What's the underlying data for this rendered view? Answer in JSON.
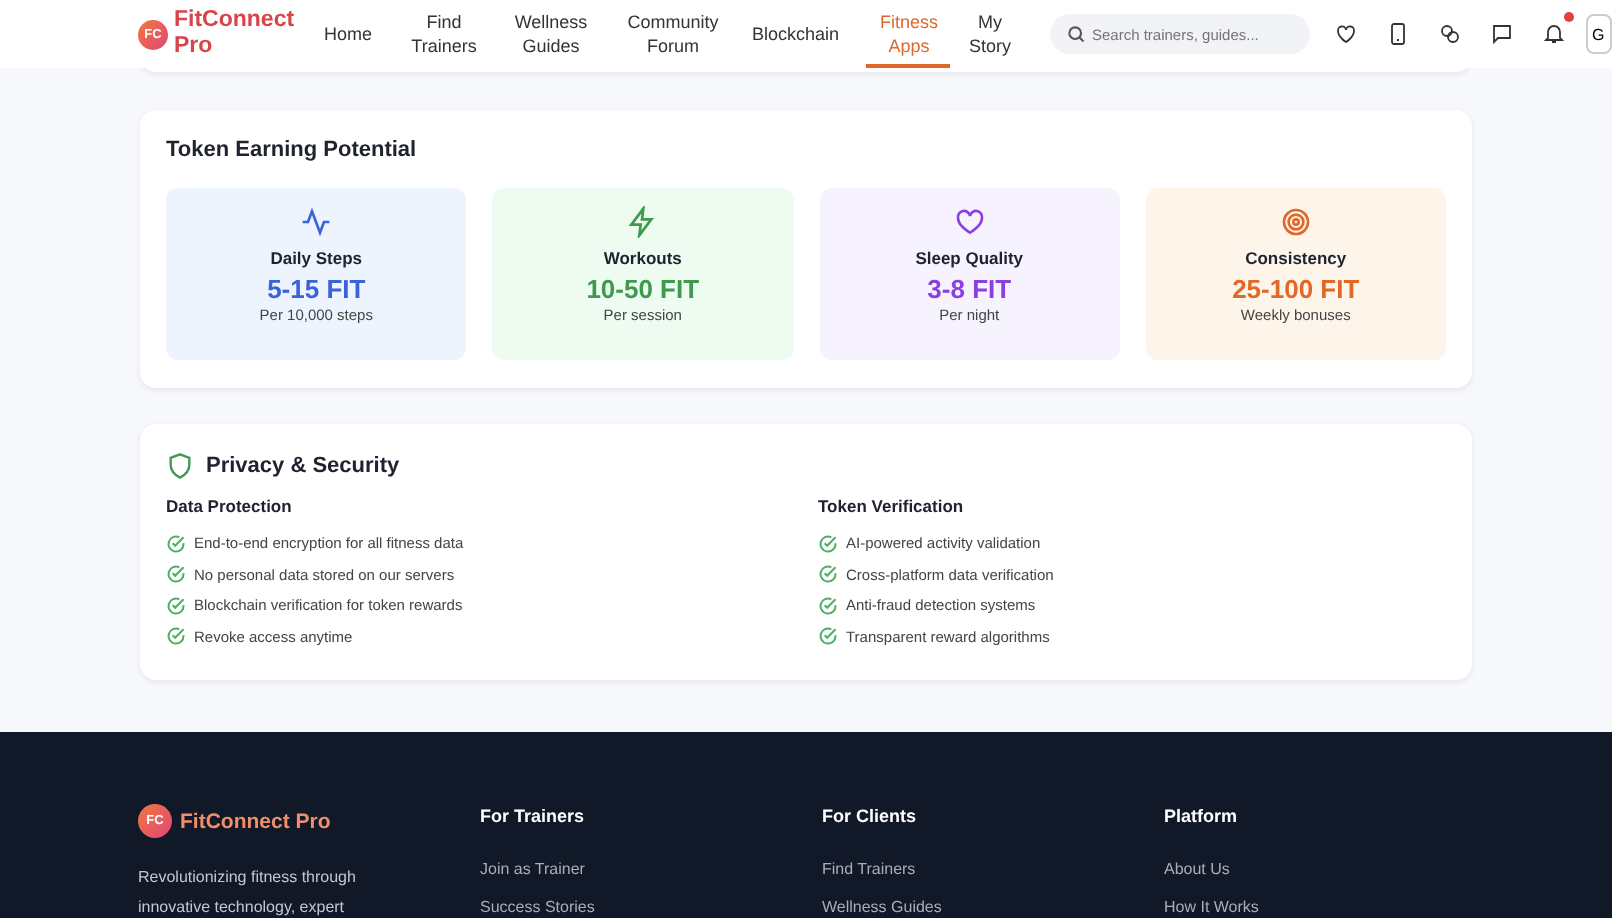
{
  "header": {
    "logo_mark": "FC",
    "logo_text": "FitConnect Pro",
    "nav": [
      {
        "label": "Home",
        "selected": false
      },
      {
        "label": "Find Trainers",
        "selected": false
      },
      {
        "label": "Wellness Guides",
        "selected": false
      },
      {
        "label": "Community Forum",
        "selected": false
      },
      {
        "label": "Blockchain",
        "selected": false
      },
      {
        "label": "Fitness Apps",
        "selected": true
      },
      {
        "label": "My Story",
        "selected": false
      }
    ],
    "search": {
      "placeholder": "Search trainers, guides..."
    },
    "notification_dot": true,
    "profile_initial": "G"
  },
  "earning": {
    "title": "Token Earning Potential",
    "cards": [
      {
        "kind": "steps",
        "title": "Daily Steps",
        "amount": "5-15 FIT",
        "note": "Per 10,000 steps",
        "color": "#3b63d8"
      },
      {
        "kind": "workouts",
        "title": "Workouts",
        "amount": "10-50 FIT",
        "note": "Per session",
        "color": "#3f9a4f"
      },
      {
        "kind": "sleep",
        "title": "Sleep Quality",
        "amount": "3-8 FIT",
        "note": "Per night",
        "color": "#8b3fe0"
      },
      {
        "kind": "consistency",
        "title": "Consistency",
        "amount": "25-100 FIT",
        "note": "Weekly bonuses",
        "color": "#e0692a"
      }
    ]
  },
  "privacy": {
    "title": "Privacy & Security",
    "columns": [
      {
        "heading": "Data Protection",
        "items": [
          "End-to-end encryption for all fitness data",
          "No personal data stored on our servers",
          "Blockchain verification for token rewards",
          "Revoke access anytime"
        ]
      },
      {
        "heading": "Token Verification",
        "items": [
          "AI-powered activity validation",
          "Cross-platform data verification",
          "Anti-fraud detection systems",
          "Transparent reward algorithms"
        ]
      }
    ]
  },
  "footer": {
    "logo_mark": "FC",
    "logo_text": "FitConnect Pro",
    "description": "Revolutionizing fitness through innovative technology, expert",
    "columns": [
      {
        "heading": "For Trainers",
        "links": [
          "Join as Trainer",
          "Success Stories"
        ]
      },
      {
        "heading": "For Clients",
        "links": [
          "Find Trainers",
          "Wellness Guides"
        ]
      },
      {
        "heading": "Platform",
        "links": [
          "About Us",
          "How It Works"
        ]
      }
    ]
  }
}
